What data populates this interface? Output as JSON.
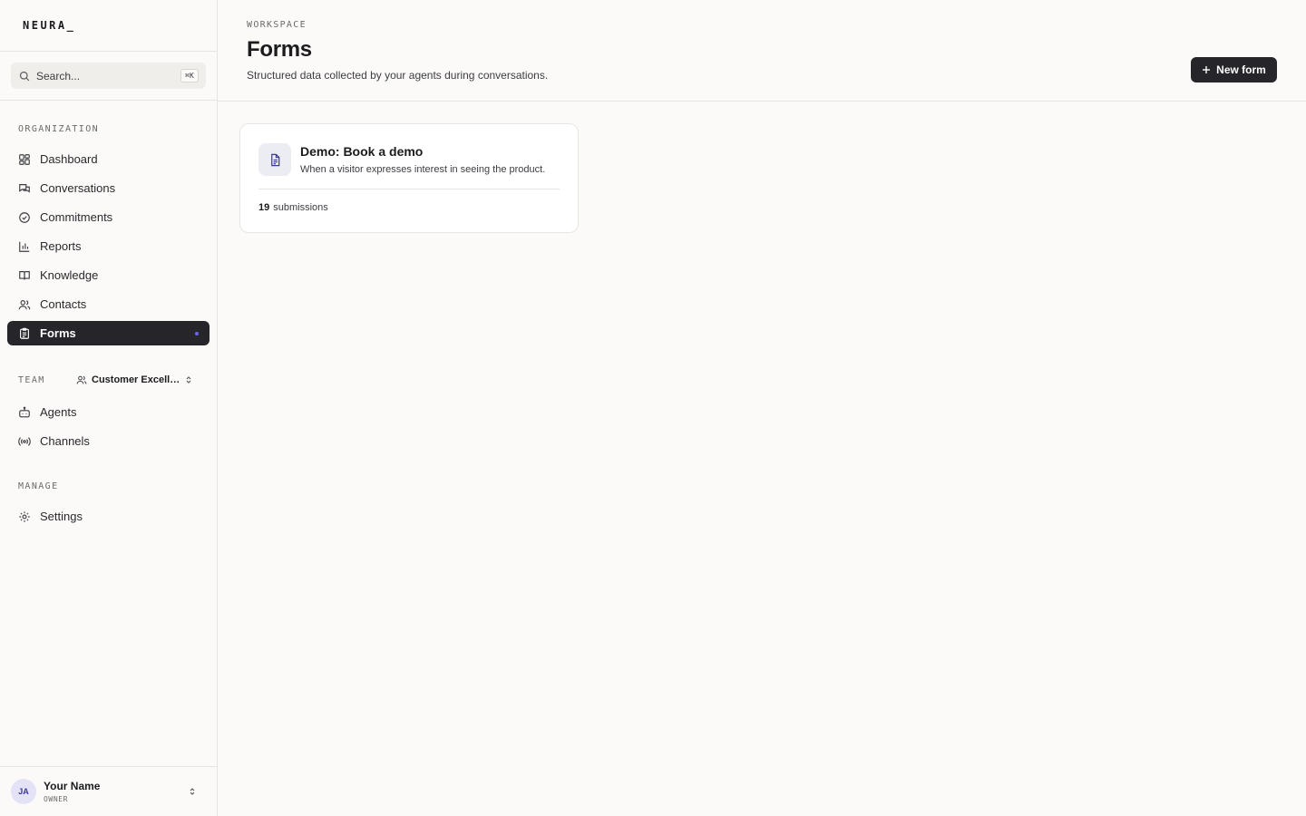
{
  "brand": {
    "logo": "NEURA_"
  },
  "search": {
    "placeholder": "Search...",
    "shortcut": "⌘K"
  },
  "sidebar": {
    "organization_label": "ORGANIZATION",
    "org_items": [
      {
        "label": "Dashboard",
        "icon": "grid-icon"
      },
      {
        "label": "Conversations",
        "icon": "chat-icon"
      },
      {
        "label": "Commitments",
        "icon": "check-circle-icon"
      },
      {
        "label": "Reports",
        "icon": "bar-chart-icon"
      },
      {
        "label": "Knowledge",
        "icon": "book-icon"
      },
      {
        "label": "Contacts",
        "icon": "users-icon"
      },
      {
        "label": "Forms",
        "icon": "clipboard-icon",
        "active": true
      }
    ],
    "team_label": "TEAM",
    "team_name": "Customer Excellence",
    "team_items": [
      {
        "label": "Agents",
        "icon": "bot-icon"
      },
      {
        "label": "Channels",
        "icon": "radio-icon"
      }
    ],
    "manage_label": "MANAGE",
    "manage_items": [
      {
        "label": "Settings",
        "icon": "gear-icon"
      }
    ]
  },
  "user": {
    "initials": "JA",
    "name": "Your Name",
    "role": "OWNER"
  },
  "header": {
    "breadcrumb": "WORKSPACE",
    "title": "Forms",
    "subtitle": "Structured data collected by your agents during conversations.",
    "new_button": "New form"
  },
  "forms": [
    {
      "title": "Demo: Book a demo",
      "description": "When a visitor expresses interest in seeing the product.",
      "submissions_count": "19",
      "submissions_label": "submissions",
      "icon": "document-icon"
    }
  ],
  "colors": {
    "active_bg": "#25252a",
    "accent_dot": "#6c63ff",
    "avatar_bg": "#e3e2f7"
  }
}
